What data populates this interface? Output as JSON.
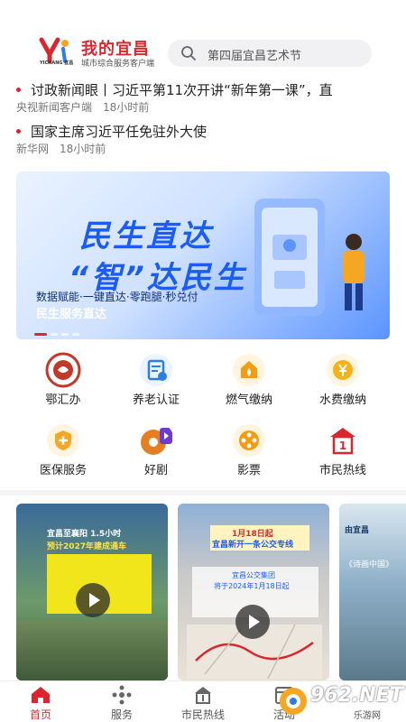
{
  "header": {
    "app_title": "我的宜昌",
    "app_subtitle": "城市综合服务客户端",
    "logo_text": "YICHANG 宜昌",
    "search_placeholder": "第四届宜昌艺术节"
  },
  "news": [
    {
      "title": "讨政新闻眼丨习近平第11次开讲“新年第一课”，直",
      "source": "央视新闻客户端",
      "time": "18小时前"
    },
    {
      "title": "国家主席习近平任免驻外大使",
      "source": "新华网",
      "time": "18小时前"
    }
  ],
  "banner": {
    "heading_1": "民生直达",
    "heading_2": "“智”达民生",
    "tagline": "数据赋能·一键直达·零跑腿·秒兑付",
    "subtitle": "民生服务直达",
    "active_slide": 1
  },
  "services": [
    {
      "label": "鄂汇办",
      "icon": "ehuiban-icon",
      "color": "#c0392b"
    },
    {
      "label": "养老认证",
      "icon": "pension-icon",
      "color": "#2f7de1"
    },
    {
      "label": "燃气缴纳",
      "icon": "gas-icon",
      "color": "#f39c12"
    },
    {
      "label": "水费缴纳",
      "icon": "water-icon",
      "color": "#f5b21b"
    },
    {
      "label": "医保服务",
      "icon": "medical-insurance-icon",
      "color": "#f5a623"
    },
    {
      "label": "好剧",
      "icon": "drama-icon",
      "color": "#e67e22"
    },
    {
      "label": "影票",
      "icon": "movie-ticket-icon",
      "color": "#f39c12"
    },
    {
      "label": "市民热线",
      "icon": "hotline-icon",
      "color": "#d7282f"
    }
  ],
  "videos": [
    {
      "caption_1": "宜昌至襄阳 1.5小时",
      "caption_2": "预计2027年建成通车"
    },
    {
      "caption_1": "1月18日起",
      "caption_2": "宜昌新开一条公交专线",
      "caption_3": "宜昌公交集团",
      "caption_4": "将于2024年1月18日起"
    },
    {
      "caption_1": "由宜昌",
      "caption_2": "《诗画中国》"
    }
  ],
  "tabbar": [
    {
      "label": "首页",
      "icon": "home-icon",
      "active": true
    },
    {
      "label": "服务",
      "icon": "services-icon",
      "active": false
    },
    {
      "label": "市民热线",
      "icon": "hotline-icon",
      "active": false
    },
    {
      "label": "活动",
      "icon": "activity-icon",
      "active": false
    }
  ],
  "watermark": {
    "main": "962.NET",
    "sub": "乐游网"
  },
  "colors": {
    "brand_red": "#d7282f",
    "banner_blue": "#1b5cf5"
  }
}
